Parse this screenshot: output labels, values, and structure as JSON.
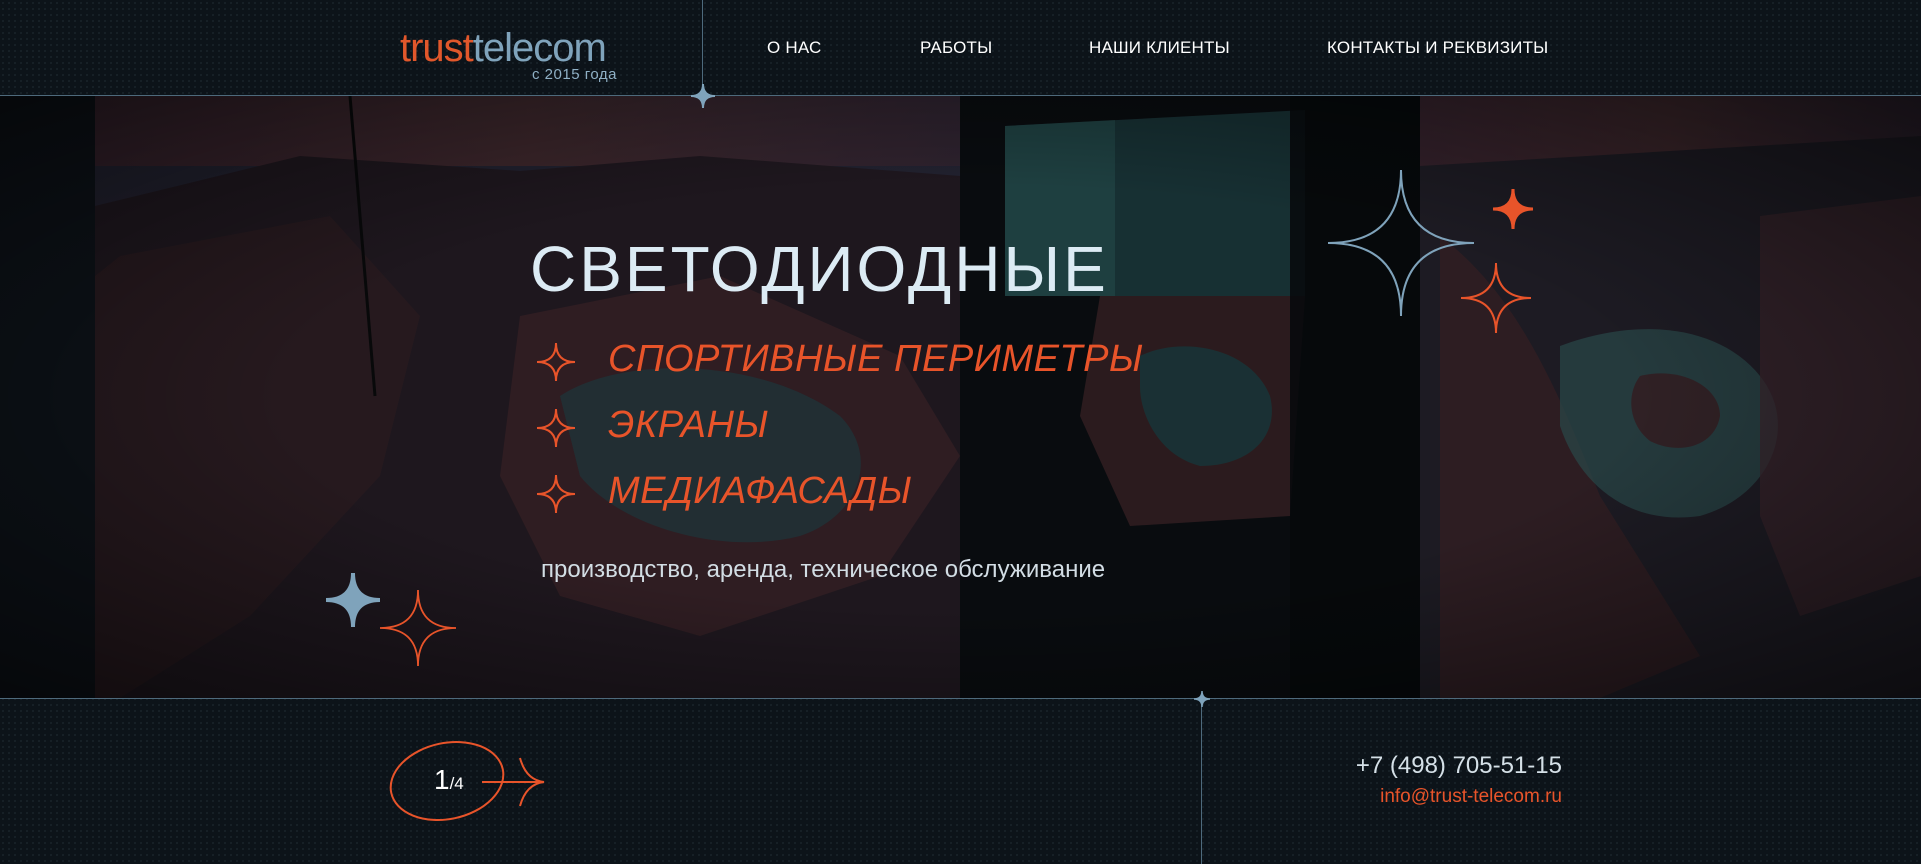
{
  "brand": {
    "logo_part1": "trust",
    "logo_part2": "telecom",
    "since": "с 2015 года",
    "colors": {
      "accent": "#e8542a",
      "secondary": "#7fa3bb",
      "background": "#0c1319",
      "line": "#4e6a7c"
    }
  },
  "nav": {
    "items": [
      {
        "label": "О НАС"
      },
      {
        "label": "РАБОТЫ"
      },
      {
        "label": "НАШИ КЛИЕНТЫ"
      },
      {
        "label": "КОНТАКТЫ И РЕКВИЗИТЫ"
      }
    ]
  },
  "hero": {
    "title": "СВЕТОДИОДНЫЕ",
    "services": [
      {
        "label": "СПОРТИВНЫЕ ПЕРИМЕТРЫ",
        "icon": "star-outline-icon"
      },
      {
        "label": "ЭКРАНЫ",
        "icon": "star-outline-icon"
      },
      {
        "label": "МЕДИАФАСАДЫ",
        "icon": "star-outline-icon"
      }
    ],
    "subtitle": "производство, аренда, техническое обслуживание"
  },
  "slider": {
    "current": "1",
    "total": "/4",
    "next_icon": "arrow-right-icon"
  },
  "contacts": {
    "phone": "+7 (498) 705-51-15",
    "email": "info@trust-telecom.ru"
  }
}
